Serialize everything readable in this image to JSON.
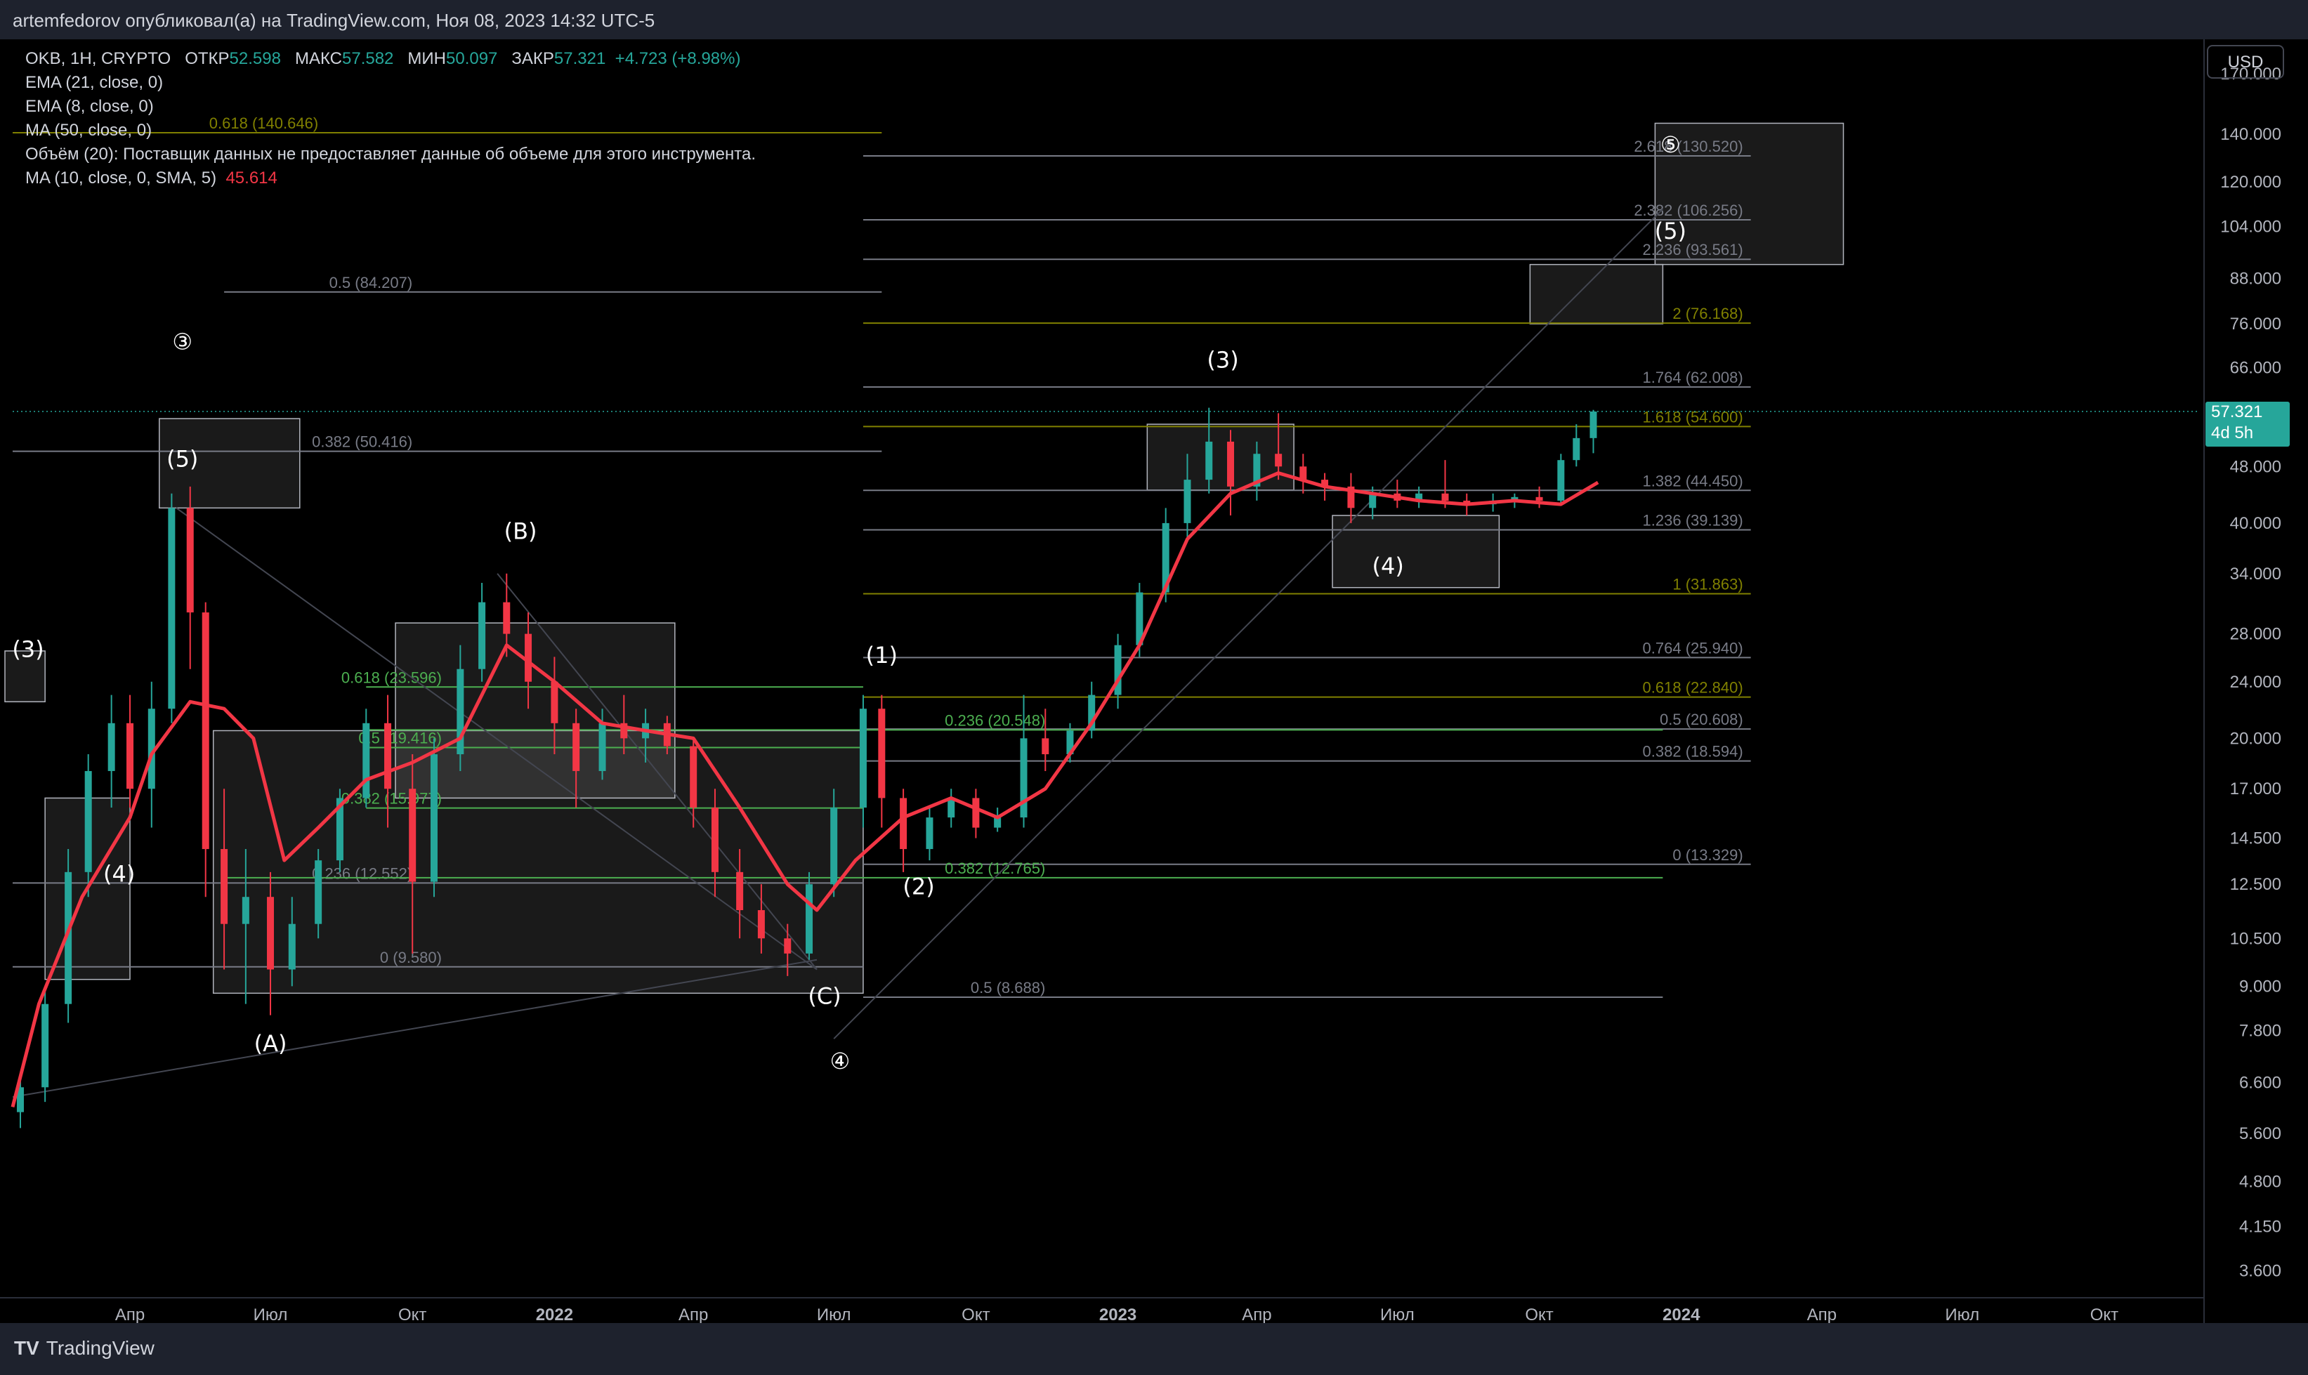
{
  "header": {
    "attribution": "artemfedorov опубликовал(а) на TradingView.com, Ноя 08, 2023 14:32 UTC-5",
    "symbol": "OKB, 1H, CRYPTO",
    "open_label": "ОТКР",
    "open": "52.598",
    "high_label": "МАКС",
    "high": "57.582",
    "low_label": "МИН",
    "low": "50.097",
    "close_label": "ЗАКР",
    "close": "57.321",
    "change": "+4.723 (+8.98%)",
    "indicators": [
      "EMA (21, close, 0)",
      "EMA (8, close, 0)",
      "MA (50, close, 0)",
      "Объём (20): Поставщик данных не предоставляет данные об объеме для этого инструмента."
    ],
    "ma10_label": "MA (10, close, 0, SMA, 5)",
    "ma10_value": "45.614"
  },
  "price_axis": {
    "currency_button": "USD",
    "last_price": "57.321",
    "countdown": "4d 5h"
  },
  "footer": {
    "brand": "TradingView"
  },
  "colors": {
    "background": "#000000",
    "up_candle": "#26a69a",
    "down_candle": "#f23645",
    "ma_line": "#f23645",
    "fib_grey": "#787b86",
    "fib_olive": "#808000",
    "fib_green": "#4caf50"
  },
  "chart_data": {
    "type": "candlestick",
    "scale": "log",
    "ylim": [
      3.3,
      190
    ],
    "xlim": [
      "2021-01-15",
      "2024-12-01"
    ],
    "y_ticks": [
      "170.000",
      "140.000",
      "120.000",
      "104.000",
      "88.000",
      "76.000",
      "66.000",
      "57.321",
      "48.000",
      "40.000",
      "34.000",
      "28.000",
      "24.000",
      "20.000",
      "17.000",
      "14.500",
      "12.500",
      "10.500",
      "9.000",
      "7.800",
      "6.600",
      "5.600",
      "4.800",
      "4.150",
      "3.600"
    ],
    "x_ticks": [
      {
        "label": "Апр",
        "date": "2021-04-01",
        "bold": false
      },
      {
        "label": "Июл",
        "date": "2021-07-01",
        "bold": false
      },
      {
        "label": "Окт",
        "date": "2021-10-01",
        "bold": false
      },
      {
        "label": "2022",
        "date": "2022-01-01",
        "bold": true
      },
      {
        "label": "Апр",
        "date": "2022-04-01",
        "bold": false
      },
      {
        "label": "Июл",
        "date": "2022-07-01",
        "bold": false
      },
      {
        "label": "Окт",
        "date": "2022-10-01",
        "bold": false
      },
      {
        "label": "2023",
        "date": "2023-01-01",
        "bold": true
      },
      {
        "label": "Апр",
        "date": "2023-04-01",
        "bold": false
      },
      {
        "label": "Июл",
        "date": "2023-07-01",
        "bold": false
      },
      {
        "label": "Окт",
        "date": "2023-10-01",
        "bold": false
      },
      {
        "label": "2024",
        "date": "2024-01-01",
        "bold": true
      },
      {
        "label": "Апр",
        "date": "2024-04-01",
        "bold": false
      },
      {
        "label": "Июл",
        "date": "2024-07-01",
        "bold": false
      },
      {
        "label": "Окт",
        "date": "2024-10-01",
        "bold": false
      }
    ],
    "ma_series": [
      [
        "2021-01-15",
        6.1
      ],
      [
        "2021-02-01",
        8.5
      ],
      [
        "2021-03-01",
        12
      ],
      [
        "2021-04-01",
        15.5
      ],
      [
        "2021-04-15",
        19
      ],
      [
        "2021-05-10",
        22.5
      ],
      [
        "2021-06-01",
        22
      ],
      [
        "2021-06-20",
        20
      ],
      [
        "2021-07-10",
        13.5
      ],
      [
        "2021-08-01",
        15
      ],
      [
        "2021-09-01",
        17.5
      ],
      [
        "2021-10-01",
        18.5
      ],
      [
        "2021-11-01",
        20
      ],
      [
        "2021-12-01",
        27
      ],
      [
        "2022-01-01",
        24
      ],
      [
        "2022-02-01",
        21
      ],
      [
        "2022-03-01",
        20.5
      ],
      [
        "2022-04-01",
        20
      ],
      [
        "2022-05-01",
        16
      ],
      [
        "2022-06-01",
        12.5
      ],
      [
        "2022-06-20",
        11.5
      ],
      [
        "2022-07-15",
        13.5
      ],
      [
        "2022-08-15",
        15.5
      ],
      [
        "2022-09-15",
        16.5
      ],
      [
        "2022-10-15",
        15.5
      ],
      [
        "2022-11-15",
        17
      ],
      [
        "2022-12-15",
        21
      ],
      [
        "2023-01-15",
        27
      ],
      [
        "2023-02-15",
        38
      ],
      [
        "2023-03-15",
        44
      ],
      [
        "2023-04-15",
        47
      ],
      [
        "2023-05-15",
        45
      ],
      [
        "2023-06-15",
        44
      ],
      [
        "2023-07-15",
        43
      ],
      [
        "2023-08-15",
        42.5
      ],
      [
        "2023-09-15",
        43
      ],
      [
        "2023-10-15",
        42.5
      ],
      [
        "2023-11-08",
        45.6
      ]
    ],
    "candles": [
      [
        "2021-01-20",
        6,
        6.8,
        5.7,
        6.5
      ],
      [
        "2021-02-05",
        6.5,
        9,
        6.2,
        8.5
      ],
      [
        "2021-02-20",
        8.5,
        14,
        8,
        13
      ],
      [
        "2021-03-05",
        13,
        19,
        12,
        18
      ],
      [
        "2021-03-20",
        18,
        23,
        16,
        21
      ],
      [
        "2021-04-01",
        21,
        23,
        16,
        17
      ],
      [
        "2021-04-15",
        17,
        24,
        15,
        22
      ],
      [
        "2021-04-28",
        22,
        44,
        21,
        42
      ],
      [
        "2021-05-10",
        42,
        45,
        25,
        30
      ],
      [
        "2021-05-20",
        30,
        31,
        12,
        14
      ],
      [
        "2021-06-01",
        14,
        17,
        9.5,
        11
      ],
      [
        "2021-06-15",
        11,
        14,
        8.5,
        12
      ],
      [
        "2021-07-01",
        12,
        13,
        8.2,
        9.5
      ],
      [
        "2021-07-15",
        9.5,
        12,
        9,
        11
      ],
      [
        "2021-08-01",
        11,
        14,
        10.5,
        13.5
      ],
      [
        "2021-08-15",
        13.5,
        17,
        13,
        16.5
      ],
      [
        "2021-09-01",
        16.5,
        22,
        16,
        21
      ],
      [
        "2021-09-15",
        21,
        23,
        15,
        17
      ],
      [
        "2021-10-01",
        17,
        19,
        10,
        12.6
      ],
      [
        "2021-10-15",
        12.6,
        20,
        12,
        19
      ],
      [
        "2021-11-01",
        19,
        27,
        18,
        25
      ],
      [
        "2021-11-15",
        25,
        33,
        24,
        31
      ],
      [
        "2021-12-01",
        31,
        34,
        26,
        28
      ],
      [
        "2021-12-15",
        28,
        30,
        22,
        24
      ],
      [
        "2022-01-01",
        24,
        26,
        19,
        21
      ],
      [
        "2022-01-15",
        21,
        22,
        16,
        18
      ],
      [
        "2022-02-01",
        18,
        22,
        17.5,
        21
      ],
      [
        "2022-02-15",
        21,
        23,
        19,
        20
      ],
      [
        "2022-03-01",
        20,
        22,
        18.5,
        21
      ],
      [
        "2022-03-15",
        21,
        21.5,
        19,
        19.5
      ],
      [
        "2022-04-01",
        19.5,
        20,
        15,
        16
      ],
      [
        "2022-04-15",
        16,
        17,
        12,
        13
      ],
      [
        "2022-05-01",
        13,
        14,
        10.5,
        11.5
      ],
      [
        "2022-05-15",
        11.5,
        12.5,
        10,
        10.5
      ],
      [
        "2022-06-01",
        10.5,
        11,
        9.3,
        10
      ],
      [
        "2022-06-15",
        10,
        13,
        9.8,
        12.5
      ],
      [
        "2022-07-01",
        12.5,
        17,
        12,
        16
      ],
      [
        "2022-07-20",
        16,
        23,
        15,
        22
      ],
      [
        "2022-08-01",
        22,
        23,
        15,
        16.5
      ],
      [
        "2022-08-15",
        16.5,
        17,
        13,
        14
      ],
      [
        "2022-09-01",
        14,
        16,
        13.5,
        15.5
      ],
      [
        "2022-09-15",
        15.5,
        17,
        15,
        16.5
      ],
      [
        "2022-10-01",
        16.5,
        17,
        14.5,
        15
      ],
      [
        "2022-10-15",
        15,
        16,
        14.8,
        15.5
      ],
      [
        "2022-11-01",
        15.5,
        23,
        15,
        20
      ],
      [
        "2022-11-15",
        20,
        22,
        18,
        19
      ],
      [
        "2022-12-01",
        19,
        21,
        18.5,
        20.5
      ],
      [
        "2022-12-15",
        20.5,
        24,
        20,
        23
      ],
      [
        "2023-01-01",
        23,
        28,
        22,
        27
      ],
      [
        "2023-01-15",
        27,
        33,
        26,
        32
      ],
      [
        "2023-02-01",
        32,
        42,
        31,
        40
      ],
      [
        "2023-02-15",
        40,
        50,
        38,
        46
      ],
      [
        "2023-03-01",
        46,
        58,
        44,
        52
      ],
      [
        "2023-03-15",
        52,
        54,
        41,
        45
      ],
      [
        "2023-04-01",
        45,
        52,
        43,
        50
      ],
      [
        "2023-04-15",
        50,
        57,
        46,
        48
      ],
      [
        "2023-05-01",
        48,
        50,
        44,
        46
      ],
      [
        "2023-05-15",
        46,
        47,
        43,
        45
      ],
      [
        "2023-06-01",
        45,
        47,
        40,
        42
      ],
      [
        "2023-06-15",
        42,
        45,
        40.5,
        44
      ],
      [
        "2023-07-01",
        44,
        46,
        42,
        43
      ],
      [
        "2023-07-15",
        43,
        45,
        42,
        44
      ],
      [
        "2023-08-01",
        44,
        49,
        42,
        43
      ],
      [
        "2023-08-15",
        43,
        44,
        41,
        42.5
      ],
      [
        "2023-09-01",
        42.5,
        44,
        41.5,
        43
      ],
      [
        "2023-09-15",
        43,
        44,
        42,
        43.5
      ],
      [
        "2023-10-01",
        43.5,
        45,
        42,
        43
      ],
      [
        "2023-10-15",
        43,
        50,
        42.5,
        49
      ],
      [
        "2023-10-25",
        49,
        55,
        48,
        52.6
      ],
      [
        "2023-11-05",
        52.6,
        57.6,
        50.1,
        57.3
      ]
    ],
    "fib_levels": [
      {
        "label": "0.618 (140.646)",
        "value": 140.646,
        "x_from": "2021-01-15",
        "x_to": "2022-08-01",
        "color": "olive",
        "label_at": "2021-08-01"
      },
      {
        "label": "0.5 (84.207)",
        "value": 84.207,
        "x_from": "2021-06-01",
        "x_to": "2022-08-01",
        "color": "grey",
        "label_at": "2021-10-01"
      },
      {
        "label": "0.382 (50.416)",
        "value": 50.416,
        "x_from": "2021-01-15",
        "x_to": "2022-08-01",
        "color": "grey",
        "label_at": "2021-10-01"
      },
      {
        "label": "0.618 (23.596)",
        "value": 23.596,
        "x_from": "2021-09-01",
        "x_to": "2022-07-20",
        "color": "green",
        "label_at": "2021-10-20"
      },
      {
        "label": "0.5 (19.416)",
        "value": 19.416,
        "x_from": "2021-09-01",
        "x_to": "2022-07-20",
        "color": "green",
        "label_at": "2021-10-20"
      },
      {
        "label": "0.382 (15.977)",
        "value": 15.977,
        "x_from": "2021-09-01",
        "x_to": "2022-07-20",
        "color": "green",
        "label_at": "2021-10-20"
      },
      {
        "label": "0.236 (12.552)",
        "value": 12.552,
        "x_from": "2021-01-15",
        "x_to": "2022-07-20",
        "color": "grey",
        "label_at": "2021-10-01"
      },
      {
        "label": "0 (9.580)",
        "value": 9.58,
        "x_from": "2021-01-15",
        "x_to": "2022-07-20",
        "color": "grey",
        "label_at": "2021-10-20"
      },
      {
        "label": "2.618 (130.520)",
        "value": 130.52,
        "x_from": "2022-07-20",
        "x_to": "2024-02-15",
        "color": "grey",
        "label_at": "2024-02-10"
      },
      {
        "label": "2.382 (106.256)",
        "value": 106.256,
        "x_from": "2022-07-20",
        "x_to": "2024-02-15",
        "color": "grey",
        "label_at": "2024-02-10"
      },
      {
        "label": "2.236 (93.561)",
        "value": 93.561,
        "x_from": "2022-07-20",
        "x_to": "2024-02-15",
        "color": "grey",
        "label_at": "2024-02-10"
      },
      {
        "label": "2 (76.168)",
        "value": 76.168,
        "x_from": "2022-07-20",
        "x_to": "2024-02-15",
        "color": "olive",
        "label_at": "2024-02-10"
      },
      {
        "label": "1.764 (62.008)",
        "value": 62.008,
        "x_from": "2022-07-20",
        "x_to": "2024-02-15",
        "color": "grey",
        "label_at": "2024-02-10"
      },
      {
        "label": "1.618 (54.600)",
        "value": 54.6,
        "x_from": "2022-07-20",
        "x_to": "2024-02-15",
        "color": "olive",
        "label_at": "2024-02-10"
      },
      {
        "label": "1.382 (44.450)",
        "value": 44.45,
        "x_from": "2022-07-20",
        "x_to": "2024-02-15",
        "color": "grey",
        "label_at": "2024-02-10"
      },
      {
        "label": "1.236 (39.139)",
        "value": 39.139,
        "x_from": "2022-07-20",
        "x_to": "2024-02-15",
        "color": "grey",
        "label_at": "2024-02-10"
      },
      {
        "label": "1 (31.863)",
        "value": 31.863,
        "x_from": "2022-07-20",
        "x_to": "2024-02-15",
        "color": "olive",
        "label_at": "2024-02-10"
      },
      {
        "label": "0.764 (25.940)",
        "value": 25.94,
        "x_from": "2022-07-20",
        "x_to": "2024-02-15",
        "color": "grey",
        "label_at": "2024-02-10"
      },
      {
        "label": "0.618 (22.840)",
        "value": 22.84,
        "x_from": "2022-07-20",
        "x_to": "2024-02-15",
        "color": "olive",
        "label_at": "2024-02-10"
      },
      {
        "label": "0.5 (20.608)",
        "value": 20.608,
        "x_from": "2022-07-20",
        "x_to": "2024-02-15",
        "color": "grey",
        "label_at": "2024-02-10"
      },
      {
        "label": "0.382 (18.594)",
        "value": 18.594,
        "x_from": "2022-07-20",
        "x_to": "2024-02-15",
        "color": "grey",
        "label_at": "2024-02-10"
      },
      {
        "label": "0 (13.329)",
        "value": 13.329,
        "x_from": "2022-07-20",
        "x_to": "2024-02-15",
        "color": "grey",
        "label_at": "2024-02-10"
      },
      {
        "label": "0.236 (20.548)",
        "value": 20.548,
        "x_from": "2021-09-01",
        "x_to": "2023-12-20",
        "color": "green",
        "label_at": "2022-11-15"
      },
      {
        "label": "0.382 (12.765)",
        "value": 12.765,
        "x_from": "2021-06-01",
        "x_to": "2023-12-20",
        "color": "green",
        "label_at": "2022-11-15"
      },
      {
        "label": "0.5 (8.688)",
        "value": 8.688,
        "x_from": "2022-07-20",
        "x_to": "2023-12-20",
        "color": "grey",
        "label_at": "2022-11-15"
      }
    ],
    "wave_labels": [
      {
        "text": "③",
        "date": "2021-05-05",
        "value": 70
      },
      {
        "text": "(5)",
        "date": "2021-05-05",
        "value": 48
      },
      {
        "text": "(3)",
        "date": "2021-01-25",
        "value": 26
      },
      {
        "text": "(4)",
        "date": "2021-03-25",
        "value": 12.6
      },
      {
        "text": "(A)",
        "date": "2021-07-01",
        "value": 7.3
      },
      {
        "text": "(B)",
        "date": "2021-12-10",
        "value": 38
      },
      {
        "text": "(C)",
        "date": "2022-06-25",
        "value": 8.5
      },
      {
        "text": "④",
        "date": "2022-07-05",
        "value": 6.9
      },
      {
        "text": "(1)",
        "date": "2022-08-01",
        "value": 25.5
      },
      {
        "text": "(2)",
        "date": "2022-08-25",
        "value": 12.1
      },
      {
        "text": "(3)",
        "date": "2023-03-10",
        "value": 66
      },
      {
        "text": "(4)",
        "date": "2023-06-25",
        "value": 34
      },
      {
        "text": "⑤",
        "date": "2023-12-25",
        "value": 132
      },
      {
        "text": "(5)",
        "date": "2023-12-25",
        "value": 100
      }
    ],
    "boxes": [
      {
        "x1": "2021-04-20",
        "x2": "2021-07-20",
        "y1": 42,
        "y2": 56
      },
      {
        "x1": "2021-09-20",
        "x2": "2022-03-20",
        "y1": 16.5,
        "y2": 29
      },
      {
        "x1": "2021-05-25",
        "x2": "2022-07-20",
        "y1": 8.8,
        "y2": 20.5
      },
      {
        "x1": "2021-02-05",
        "x2": "2021-04-01",
        "y1": 9.2,
        "y2": 16.5
      },
      {
        "x1": "2021-01-10",
        "x2": "2021-02-05",
        "y1": 22.5,
        "y2": 26.5
      },
      {
        "x1": "2023-01-20",
        "x2": "2023-04-25",
        "y1": 44.5,
        "y2": 55
      },
      {
        "x1": "2023-05-20",
        "x2": "2023-09-05",
        "y1": 32.5,
        "y2": 41
      },
      {
        "x1": "2023-09-25",
        "x2": "2023-12-20",
        "y1": 76,
        "y2": 92
      },
      {
        "x1": "2023-12-15",
        "x2": "2024-04-15",
        "y1": 92,
        "y2": 145
      }
    ],
    "trend_lines": [
      [
        [
          "2022-07-01",
          7.6
        ],
        [
          "2023-12-20",
          110
        ]
      ],
      [
        [
          "2021-01-15",
          6.3
        ],
        [
          "2022-06-20",
          9.8
        ]
      ],
      [
        [
          "2021-05-01",
          42
        ],
        [
          "2022-06-20",
          9.5
        ]
      ],
      [
        [
          "2021-11-25",
          34
        ],
        [
          "2022-06-20",
          9.5
        ]
      ]
    ]
  }
}
